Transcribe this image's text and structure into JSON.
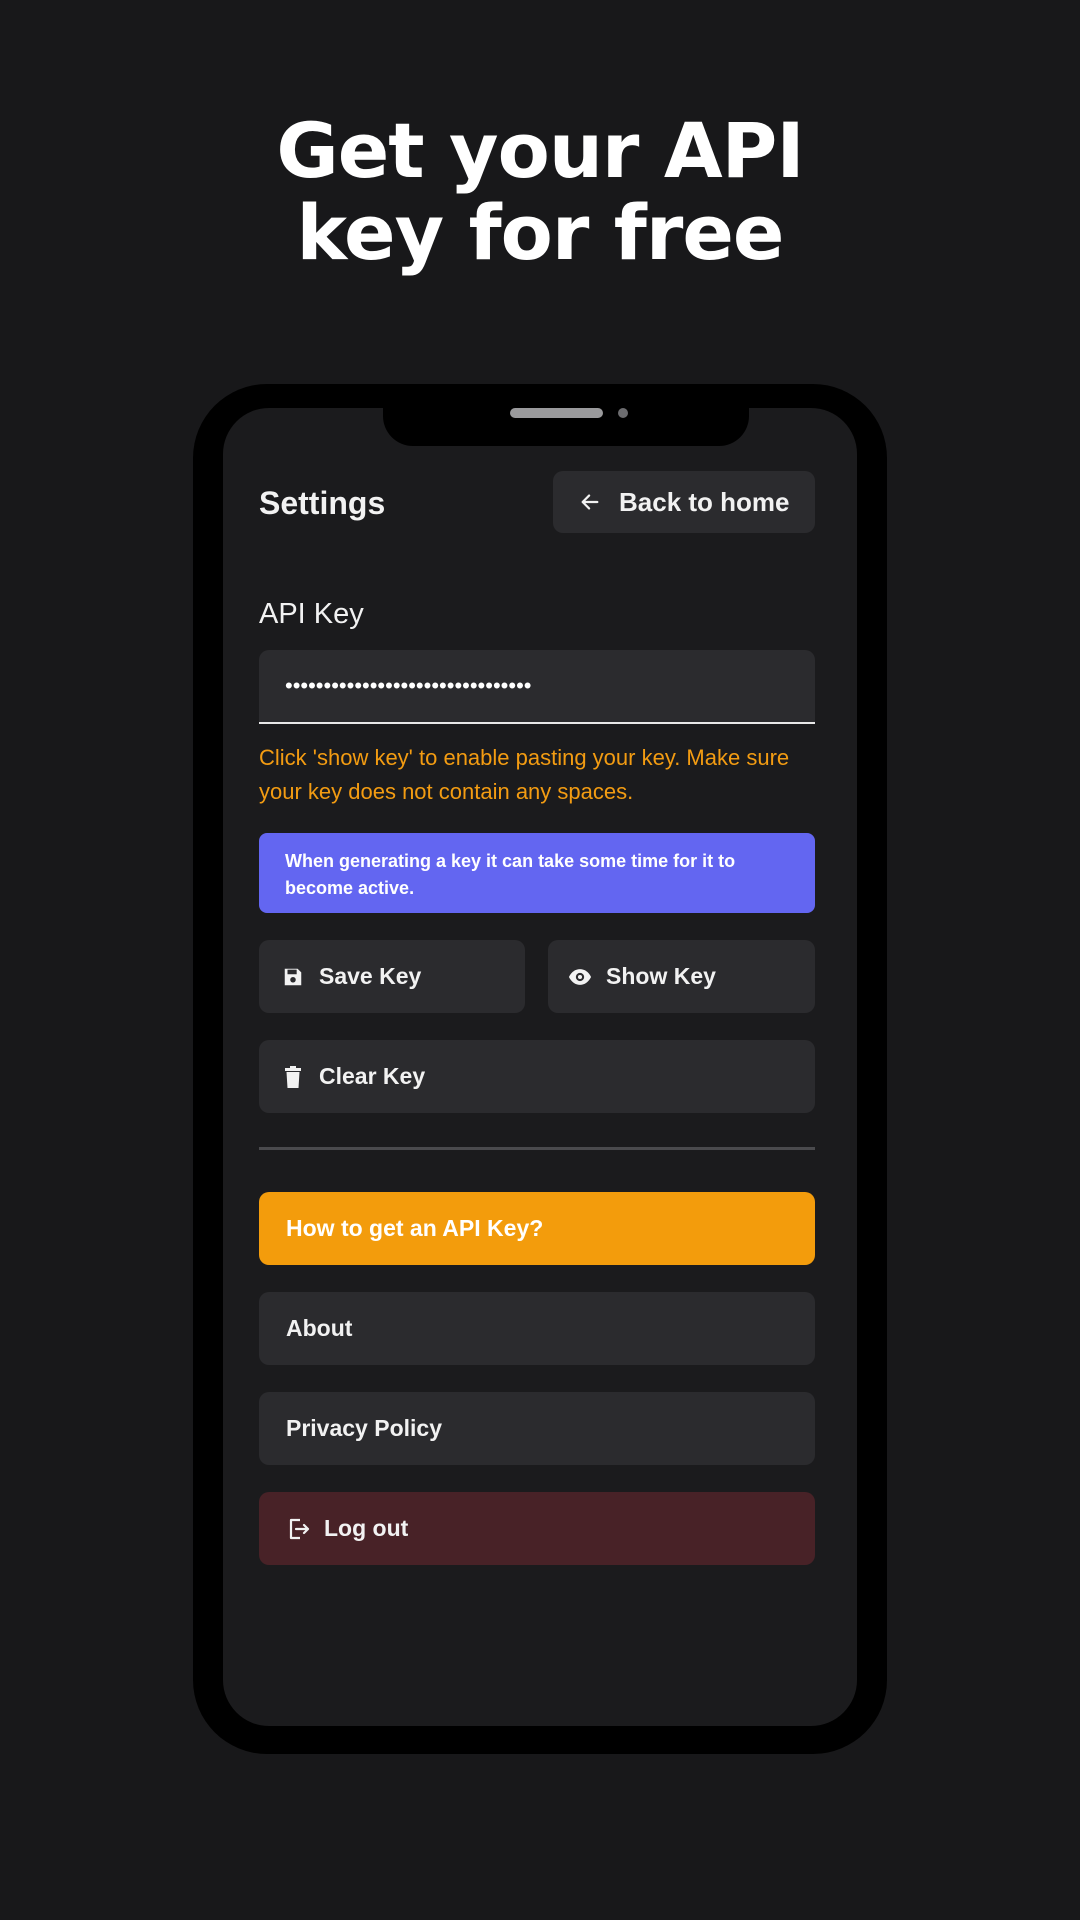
{
  "headline": {
    "line1": "Get your API",
    "line2": "key for free"
  },
  "header": {
    "title": "Settings",
    "back_label": "Back to home"
  },
  "api_key": {
    "label": "API Key",
    "value": "••••••••••••••••••••••••••••••••",
    "warning": "Click 'show key' to enable pasting your key. Make sure your key does not contain any spaces.",
    "info": "When generating a key it can take some time for it to become active."
  },
  "actions": {
    "save_label": "Save Key",
    "show_label": "Show Key",
    "clear_label": "Clear Key"
  },
  "menu": {
    "howto_label": "How to get an API Key?",
    "about_label": "About",
    "privacy_label": "Privacy Policy",
    "logout_label": "Log out"
  },
  "colors": {
    "background": "#18181a",
    "screen": "#1b1b1d",
    "button": "#2b2b2e",
    "warning": "#f39c12",
    "info": "#6366f1",
    "howto": "#f39c0c",
    "logout": "#482227"
  },
  "icons": {
    "back": "arrow-left-icon",
    "save": "floppy-disk-icon",
    "show": "eye-icon",
    "clear": "trash-icon",
    "logout": "logout-icon"
  }
}
